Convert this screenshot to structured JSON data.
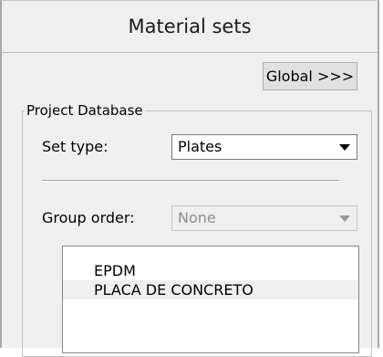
{
  "panel": {
    "title": "Material sets",
    "global_button": "Global >>>"
  },
  "project_database": {
    "legend": "Project Database",
    "set_type": {
      "label": "Set type:",
      "value": "Plates"
    },
    "group_order": {
      "label": "Group order:",
      "value": "None",
      "disabled": true
    },
    "materials": [
      {
        "name": "EPDM",
        "selected": false
      },
      {
        "name": "PLACA DE CONCRETO",
        "selected": true
      }
    ]
  }
}
